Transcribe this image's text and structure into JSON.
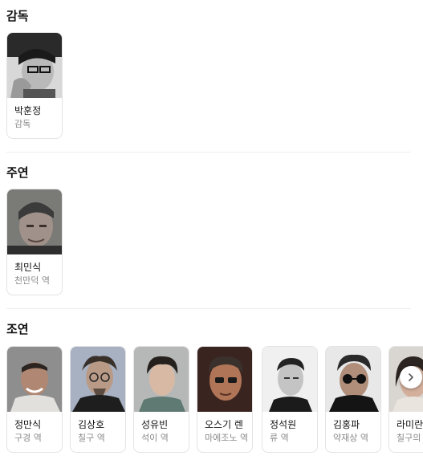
{
  "sections": {
    "director": {
      "title": "감독",
      "people": [
        {
          "name": "박훈정",
          "role": "감독"
        }
      ]
    },
    "lead": {
      "title": "주연",
      "people": [
        {
          "name": "최민식",
          "role": "천만덕 역"
        }
      ]
    },
    "supporting": {
      "title": "조연",
      "people": [
        {
          "name": "정만식",
          "role": "구경 역"
        },
        {
          "name": "김상호",
          "role": "칠구 역"
        },
        {
          "name": "성유빈",
          "role": "석이 역"
        },
        {
          "name": "오스기 렌",
          "role": "마에조노 역"
        },
        {
          "name": "정석원",
          "role": "류 역"
        },
        {
          "name": "김홍파",
          "role": "약재상 역"
        },
        {
          "name": "라미란",
          "role": "칠구의 내 역"
        }
      ]
    }
  },
  "controls": {
    "next_icon": "chevron-right-icon"
  },
  "colors": {
    "text": "#111111",
    "muted": "#8a8a8a",
    "border": "#e3e3e3"
  }
}
